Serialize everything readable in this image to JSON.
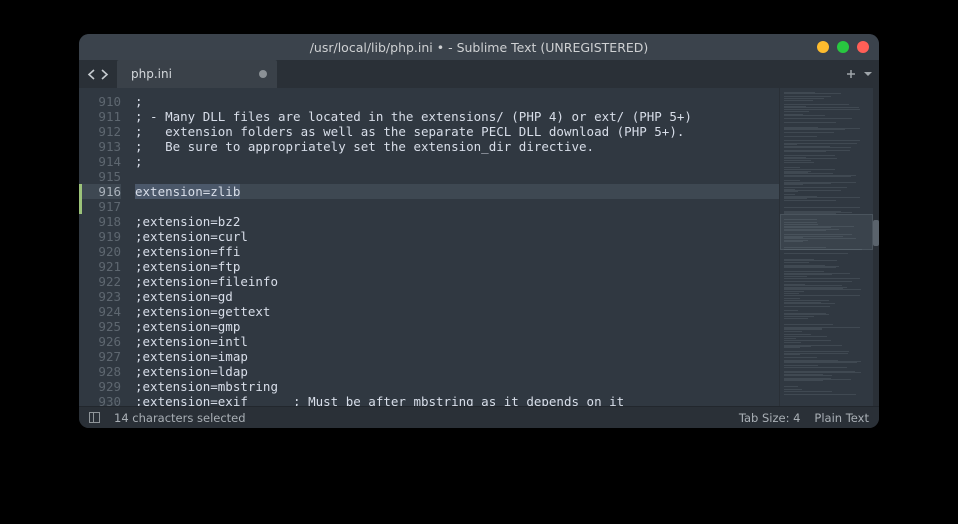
{
  "window": {
    "title": "/usr/local/lib/php.ini • - Sublime Text (UNREGISTERED)",
    "traffic": {
      "close": "#ff5f57",
      "min": "#febc2e",
      "max": "#28c840"
    }
  },
  "tabs": [
    {
      "label": "php.ini",
      "dirty": true
    }
  ],
  "editor": {
    "first_line": 910,
    "selection_line": 916,
    "selection_text": "extension=zlib",
    "lines": [
      {
        "n": 910,
        "text": ";"
      },
      {
        "n": 911,
        "text": "; - Many DLL files are located in the extensions/ (PHP 4) or ext/ (PHP 5+)"
      },
      {
        "n": 912,
        "text": ";   extension folders as well as the separate PECL DLL download (PHP 5+)."
      },
      {
        "n": 913,
        "text": ";   Be sure to appropriately set the extension_dir directive."
      },
      {
        "n": 914,
        "text": ";"
      },
      {
        "n": 915,
        "text": ""
      },
      {
        "n": 916,
        "text": "extension=zlib"
      },
      {
        "n": 917,
        "text": ""
      },
      {
        "n": 918,
        "text": ";extension=bz2"
      },
      {
        "n": 919,
        "text": ";extension=curl"
      },
      {
        "n": 920,
        "text": ";extension=ffi"
      },
      {
        "n": 921,
        "text": ";extension=ftp"
      },
      {
        "n": 922,
        "text": ";extension=fileinfo"
      },
      {
        "n": 923,
        "text": ";extension=gd"
      },
      {
        "n": 924,
        "text": ";extension=gettext"
      },
      {
        "n": 925,
        "text": ";extension=gmp"
      },
      {
        "n": 926,
        "text": ";extension=intl"
      },
      {
        "n": 927,
        "text": ";extension=imap"
      },
      {
        "n": 928,
        "text": ";extension=ldap"
      },
      {
        "n": 929,
        "text": ";extension=mbstring"
      },
      {
        "n": 930,
        "text": ";extension=exif      ; Must be after mbstring as it depends on it"
      }
    ]
  },
  "statusbar": {
    "selection": "14 characters selected",
    "tab_size": "Tab Size: 4",
    "syntax": "Plain Text"
  }
}
